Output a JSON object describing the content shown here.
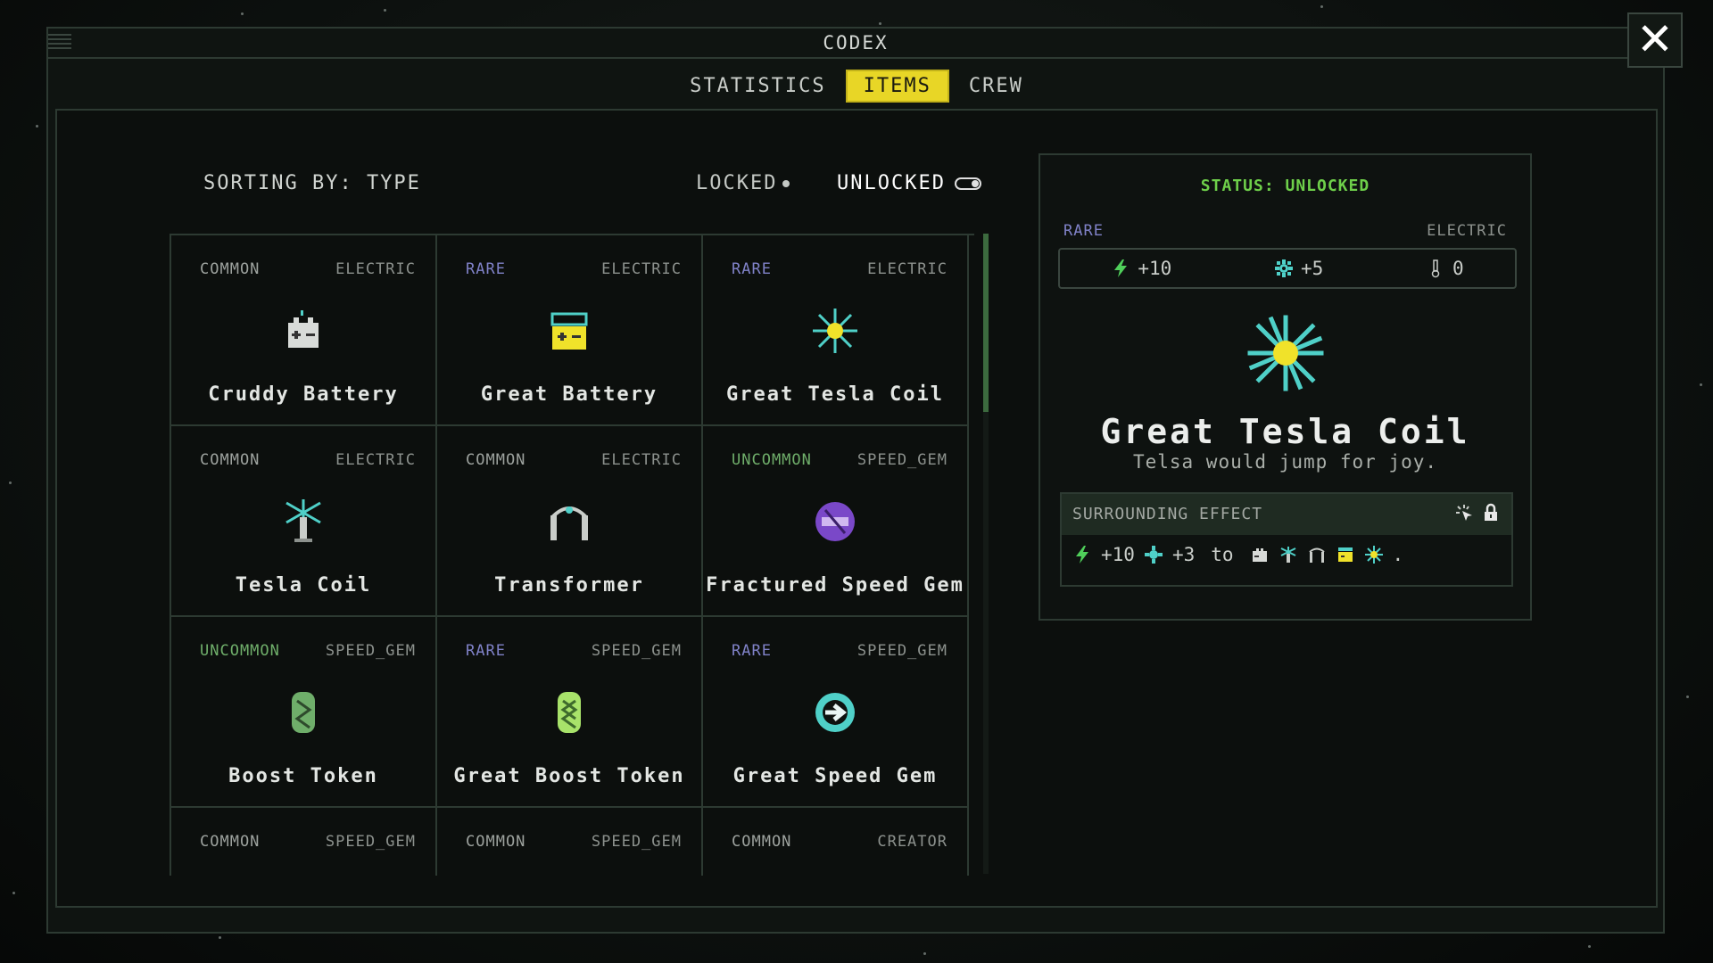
{
  "window": {
    "title": "CODEX"
  },
  "tabs": [
    {
      "label": "STATISTICS",
      "active": false
    },
    {
      "label": "ITEMS",
      "active": true
    },
    {
      "label": "CREW",
      "active": false
    }
  ],
  "sorting": {
    "label": "SORTING BY: TYPE"
  },
  "filters": {
    "locked_label": "LOCKED",
    "unlocked_label": "UNLOCKED",
    "unlocked_on": true
  },
  "items": [
    {
      "rarity": "COMMON",
      "type": "ELECTRIC",
      "name": "Cruddy Battery",
      "icon": "battery-icon"
    },
    {
      "rarity": "RARE",
      "type": "ELECTRIC",
      "name": "Great Battery",
      "icon": "great-battery-icon"
    },
    {
      "rarity": "RARE",
      "type": "ELECTRIC",
      "name": "Great Tesla Coil",
      "icon": "tesla-spark-icon"
    },
    {
      "rarity": "COMMON",
      "type": "ELECTRIC",
      "name": "Tesla Coil",
      "icon": "tesla-coil-icon"
    },
    {
      "rarity": "COMMON",
      "type": "ELECTRIC",
      "name": "Transformer",
      "icon": "transformer-icon"
    },
    {
      "rarity": "UNCOMMON",
      "type": "SPEED_GEM",
      "name": "Fractured Speed Gem",
      "icon": "fractured-gem-icon"
    },
    {
      "rarity": "UNCOMMON",
      "type": "SPEED_GEM",
      "name": "Boost Token",
      "icon": "boost-token-icon"
    },
    {
      "rarity": "RARE",
      "type": "SPEED_GEM",
      "name": "Great Boost Token",
      "icon": "great-boost-token-icon"
    },
    {
      "rarity": "RARE",
      "type": "SPEED_GEM",
      "name": "Great Speed Gem",
      "icon": "speed-gem-icon"
    },
    {
      "rarity": "COMMON",
      "type": "SPEED_GEM",
      "name": "",
      "icon": ""
    },
    {
      "rarity": "COMMON",
      "type": "SPEED_GEM",
      "name": "",
      "icon": ""
    },
    {
      "rarity": "COMMON",
      "type": "CREATOR",
      "name": "",
      "icon": ""
    }
  ],
  "detail": {
    "status": "STATUS: UNLOCKED",
    "rarity": "RARE",
    "type": "ELECTRIC",
    "stats": {
      "power": "+10",
      "speed": "+5",
      "heat": "0"
    },
    "name": "Great Tesla Coil",
    "quote": "Telsa would jump for joy.",
    "effect": {
      "title": "SURROUNDING EFFECT",
      "power": "+10",
      "speed": "+3",
      "to_label": "to",
      "suffix": "."
    }
  },
  "colors": {
    "accent": "#e8d626",
    "rare": "#8082c8",
    "uncommon": "#6fae6a",
    "status": "#6ecf4a",
    "bolt": "#4fcf5a",
    "gear": "#4fd0c8"
  }
}
